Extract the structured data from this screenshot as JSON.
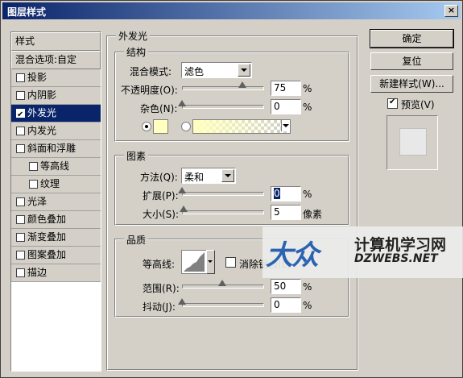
{
  "window": {
    "title": "图层样式",
    "close": "×"
  },
  "sidebar": {
    "header": "样式",
    "blend": "混合选项:自定",
    "items": [
      {
        "label": "投影",
        "checked": false
      },
      {
        "label": "内阴影",
        "checked": false
      },
      {
        "label": "外发光",
        "checked": true,
        "active": true
      },
      {
        "label": "内发光",
        "checked": false
      },
      {
        "label": "斜面和浮雕",
        "checked": false
      },
      {
        "label": "等高线",
        "checked": false,
        "sub": true
      },
      {
        "label": "纹理",
        "checked": false,
        "sub": true
      },
      {
        "label": "光泽",
        "checked": false
      },
      {
        "label": "颜色叠加",
        "checked": false
      },
      {
        "label": "渐变叠加",
        "checked": false
      },
      {
        "label": "图案叠加",
        "checked": false
      },
      {
        "label": "描边",
        "checked": false
      }
    ]
  },
  "outer_glow": {
    "title": "外发光",
    "structure": {
      "title": "结构",
      "blend_mode_label": "混合模式:",
      "blend_mode_value": "滤色",
      "opacity_label": "不透明度(O):",
      "opacity_value": "75",
      "opacity_level": 0.75,
      "noise_label": "杂色(N):",
      "noise_value": "0",
      "noise_level": 0,
      "unit": "%"
    },
    "elements": {
      "title": "图素",
      "technique_label": "方法(Q):",
      "technique_value": "柔和",
      "spread_label": "扩展(P):",
      "spread_value": "0",
      "spread_level": 0,
      "size_label": "大小(S):",
      "size_value": "5",
      "size_level": 0.02,
      "unit_percent": "%",
      "unit_px": "像素"
    },
    "quality": {
      "title": "品质",
      "contour_label": "等高线:",
      "antialias_label": "消除锯齿(L)",
      "range_label": "范围(R):",
      "range_value": "50",
      "range_level": 0.5,
      "jitter_label": "抖动(J):",
      "jitter_value": "0",
      "jitter_level": 0,
      "unit": "%"
    }
  },
  "buttons": {
    "ok": "确定",
    "reset": "复位",
    "new_style": "新建样式(W)...",
    "preview_label": "预览(V)"
  },
  "colors": {
    "glow_color": "#ffffc0"
  },
  "watermark": {
    "logo": "大众",
    "title": "计算机学习网",
    "sub": "DZWEBS.NET"
  }
}
